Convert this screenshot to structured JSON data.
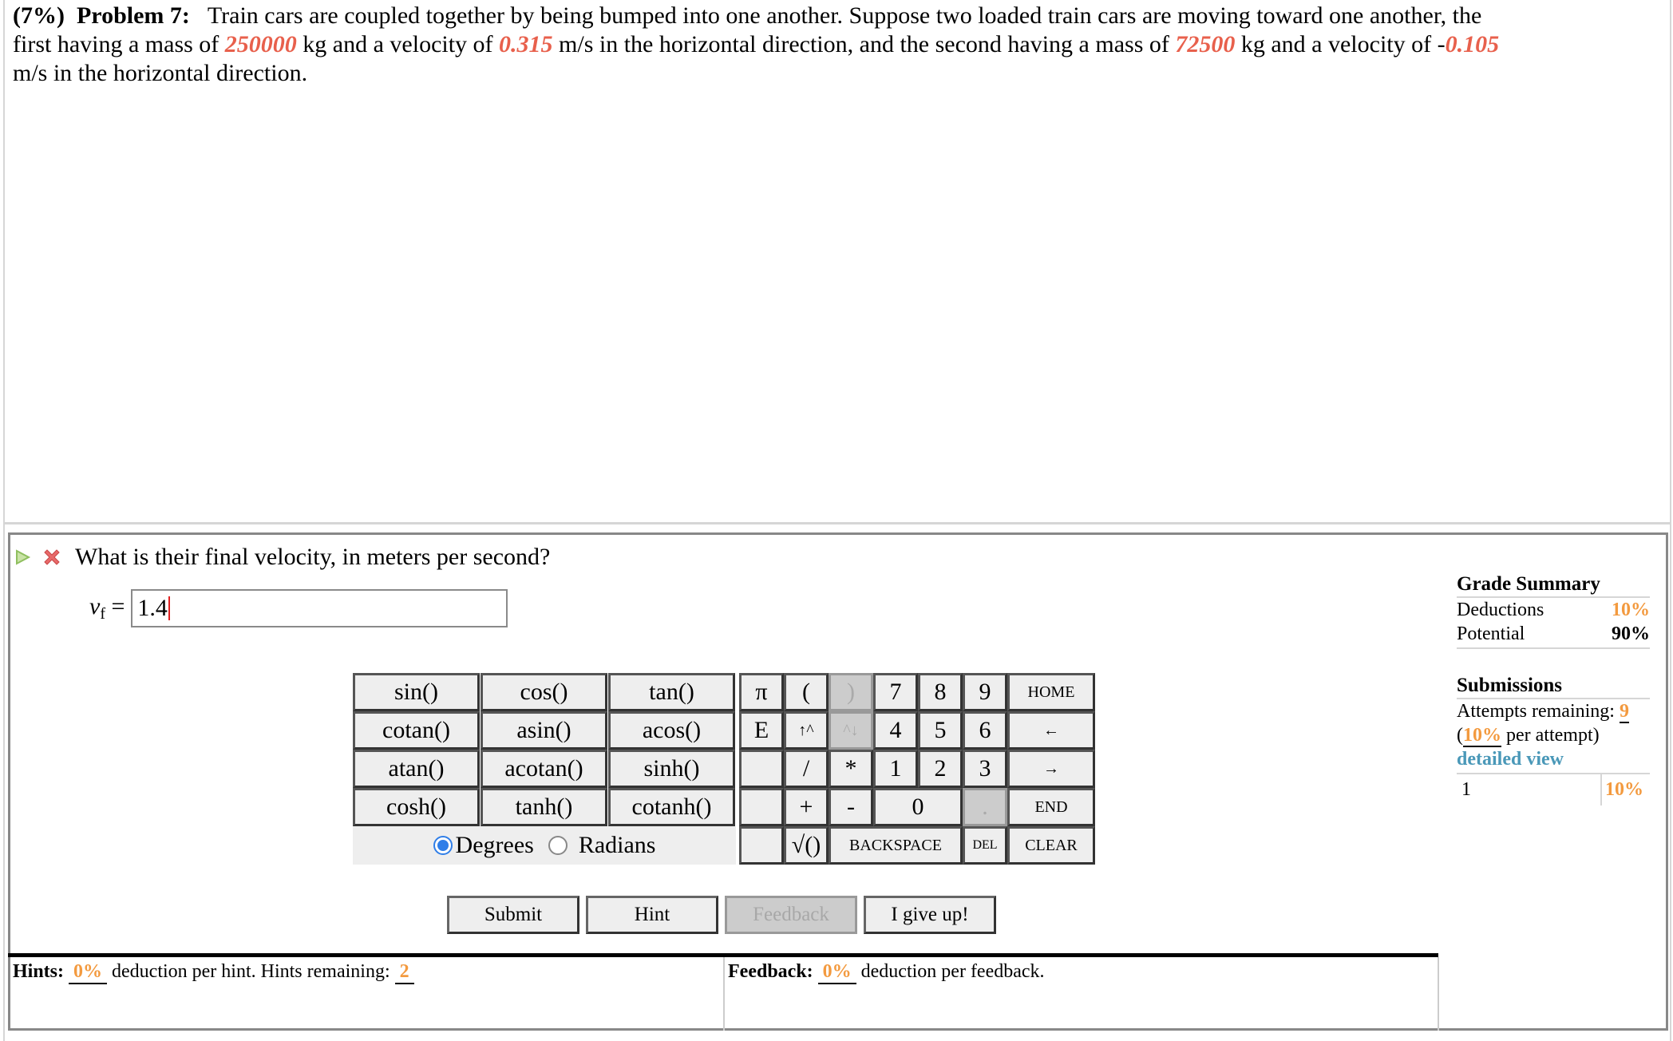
{
  "problem": {
    "weight": "(7%)",
    "title": "Problem 7:",
    "text_1": "Train cars are coupled together by being bumped into one another. Suppose two loaded train cars are moving toward one another, the first having a mass of ",
    "mass_1": "250000",
    "text_2": " kg and a velocity of ",
    "velocity_1": "0.315",
    "text_3": " m/s in the horizontal direction, and the second having a mass of ",
    "mass_2": "72500",
    "text_4": " kg and a velocity of -",
    "velocity_2": "0.105",
    "text_5": " m/s in the horizontal direction."
  },
  "question": {
    "text": "What is their final velocity, in meters per second?",
    "status_icons": [
      "play-icon",
      "incorrect-x-icon"
    ],
    "answer_symbol": "v",
    "answer_subscript": "f",
    "answer_equals": "=",
    "answer_value": "1.4"
  },
  "keypad": {
    "functions": [
      "sin()",
      "cos()",
      "tan()",
      "cotan()",
      "asin()",
      "acos()",
      "atan()",
      "acotan()",
      "sinh()",
      "cosh()",
      "tanh()",
      "cotanh()"
    ],
    "angle_modes": [
      {
        "label": "Degrees",
        "selected": true
      },
      {
        "label": "Radians",
        "selected": false
      }
    ],
    "pi": "π",
    "e": "E",
    "open_paren": "(",
    "close_paren": ")",
    "up_caret": "↑^",
    "down_caret": "^↓",
    "divide": "/",
    "multiply": "*",
    "plus": "+",
    "minus": "-",
    "sqrt": "√()",
    "backspace": "BACKSPACE",
    "del": "DEL",
    "clear": "CLEAR",
    "home": "HOME",
    "left": "←",
    "right": "→",
    "end": "END",
    "dot": ".",
    "digits": [
      "7",
      "8",
      "9",
      "4",
      "5",
      "6",
      "1",
      "2",
      "3",
      "0"
    ]
  },
  "actions": {
    "submit": "Submit",
    "hint": "Hint",
    "feedback": "Feedback",
    "give_up": "I give up!"
  },
  "hints": {
    "label": "Hints:",
    "deduction": "0%",
    "text": "deduction per hint. Hints remaining:",
    "remaining": "2"
  },
  "feedback": {
    "label": "Feedback:",
    "deduction": "0%",
    "text": "deduction per feedback."
  },
  "grade_summary": {
    "title": "Grade Summary",
    "deductions_label": "Deductions",
    "deductions_value": "10%",
    "potential_label": "Potential",
    "potential_value": "90%",
    "submissions_title": "Submissions",
    "attempts_label": "Attempts remaining:",
    "attempts_value": "9",
    "per_attempt_open": "(",
    "per_attempt_value": "10%",
    "per_attempt_text": "per attempt)",
    "detailed_view": "detailed view",
    "submissions": [
      {
        "number": "1",
        "deduction": "10%"
      }
    ]
  },
  "colors": {
    "variable_red": "#e8604c",
    "orange": "#f39a3f",
    "link_blue": "#4a98b8",
    "radio_blue": "#2f7ee8"
  }
}
